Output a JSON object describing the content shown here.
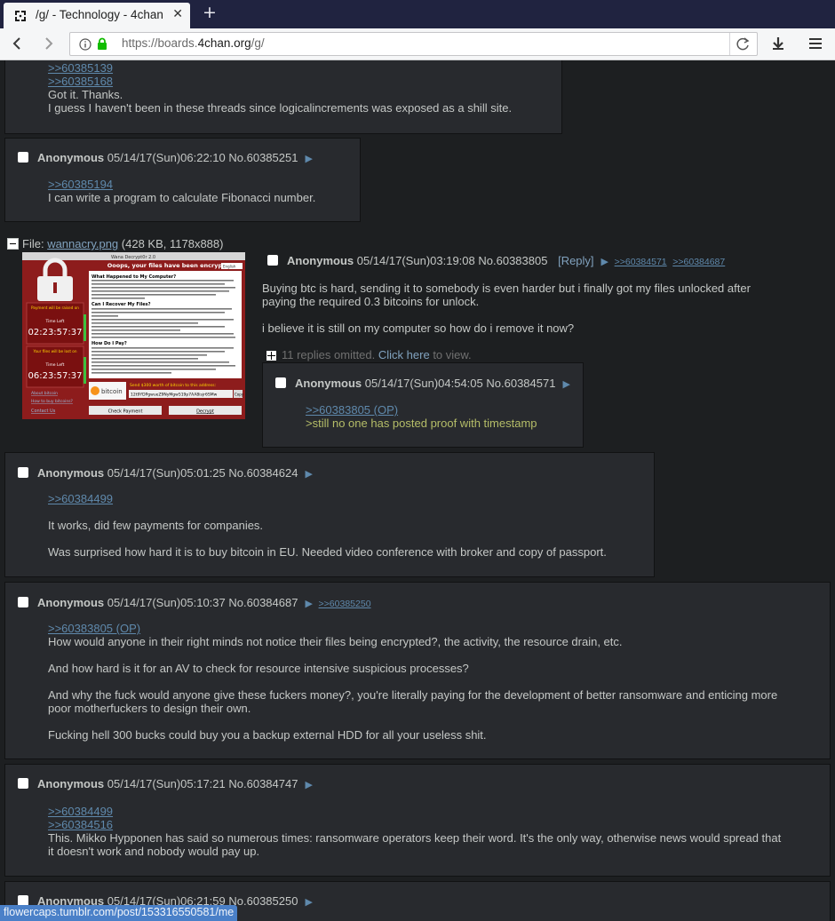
{
  "browser": {
    "tab_title": "/g/ - Technology - 4chan",
    "tab_close": "✕",
    "new_tab": "+",
    "url_prefix": "https://boards.",
    "url_host": "4chan.org",
    "url_path": "/g/",
    "status_link": "flowercaps.tumblr.com/post/153316550581/me"
  },
  "top_fragment": {
    "lines": [
      ">>60385139",
      ">>60385168",
      "Got it. Thanks.",
      "I guess I haven't been in these threads since logicalincrements was exposed as a shill site."
    ]
  },
  "reply_60385251": {
    "name": "Anonymous",
    "datetime": "05/14/17(Sun)06:22:10",
    "postno": "No.60385251",
    "quote": ">>60385194",
    "text": "I can write a program to calculate Fibonacci number."
  },
  "op": {
    "file_label": "File:",
    "file_name": "wannacry.png",
    "file_info": "(428 KB, 1178x888)",
    "name": "Anonymous",
    "datetime": "05/14/17(Sun)03:19:08",
    "postno": "No.60383805",
    "reply_link": "[Reply]",
    "backlinks": [
      ">>60384571",
      ">>60384687"
    ],
    "body": [
      "Buying btc is hard, sending it to somebody is even harder but i finally got my files unlocked after",
      "paying the required 0.3 bitcoins for unlock.",
      "",
      "i believe it is still on my computer so how do i remove it now?"
    ],
    "omitted_text": "11 replies omitted.",
    "omitted_link": "Click here",
    "omitted_suffix": "to view.",
    "thumb": {
      "title": "Wana Decrypt0r 2.0",
      "headline": "Ooops, your files have been encrypted!",
      "lang": "English",
      "q1": "What Happened to My Computer?",
      "q2": "Can I Recover My Files?",
      "q3": "How Do I Pay?",
      "raised": "Payment will be raised on",
      "lost": "Your files will be lost on",
      "time_left": "Time Left",
      "timer1": "02:23:57:37",
      "timer2": "06:23:57:37",
      "about": "About bitcoin",
      "how_buy": "How to buy bitcoins?",
      "contact": "Contact Us",
      "btc_text": "bitcoin",
      "send": "Send $300 worth of bitcoin to this address:",
      "address": "12t9YDPgwueZ9NyMgw519p7AA8isjr6SMw",
      "copy": "Copy",
      "check": "Check Payment",
      "decrypt": "Decrypt"
    }
  },
  "reply_60384571": {
    "name": "Anonymous",
    "datetime": "05/14/17(Sun)04:54:05",
    "postno": "No.60384571",
    "quote": ">>60383805 (OP)",
    "greentext": ">still no one has posted proof with timestamp"
  },
  "reply_60384624": {
    "name": "Anonymous",
    "datetime": "05/14/17(Sun)05:01:25",
    "postno": "No.60384624",
    "quote": ">>60384499",
    "p1": "It works, did few payments for companies.",
    "p2": "Was surprised how hard it is to buy bitcoin in EU. Needed video conference with broker and copy of passport."
  },
  "reply_60384687": {
    "name": "Anonymous",
    "datetime": "05/14/17(Sun)05:10:37",
    "postno": "No.60384687",
    "backlink": ">>60385250",
    "quote": ">>60383805 (OP)",
    "p1": "How would anyone in their right minds not notice their files being encrypted?, the activity, the resource drain, etc.",
    "p2": "And how hard is it for an AV to check for resource intensive suspicious processes?",
    "p3a": "And why the fuck would anyone give these fuckers money?, you're literally paying for the development of better ransomware and enticing more",
    "p3b": "poor motherfuckers to design their own.",
    "p4": "Fucking hell 300 bucks could buy you a backup external HDD for all your useless shit."
  },
  "reply_60384747": {
    "name": "Anonymous",
    "datetime": "05/14/17(Sun)05:17:21",
    "postno": "No.60384747",
    "quote1": ">>60384499",
    "quote2": ">>60384516",
    "p1a": "This. Mikko Hypponen has said so numerous times: ransomware operators keep their word. It's the only way, otherwise news would spread that",
    "p1b": "it doesn't work and nobody would pay up."
  },
  "reply_60385250": {
    "name": "Anonymous",
    "datetime": "05/14/17(Sun)06:21:59",
    "postno": "No.60385250"
  },
  "colors": {
    "background": "#1d1f21",
    "post": "#282a2e",
    "link": "#5f89ac",
    "greentext": "#b5bd68",
    "status": "#4a80c8"
  }
}
